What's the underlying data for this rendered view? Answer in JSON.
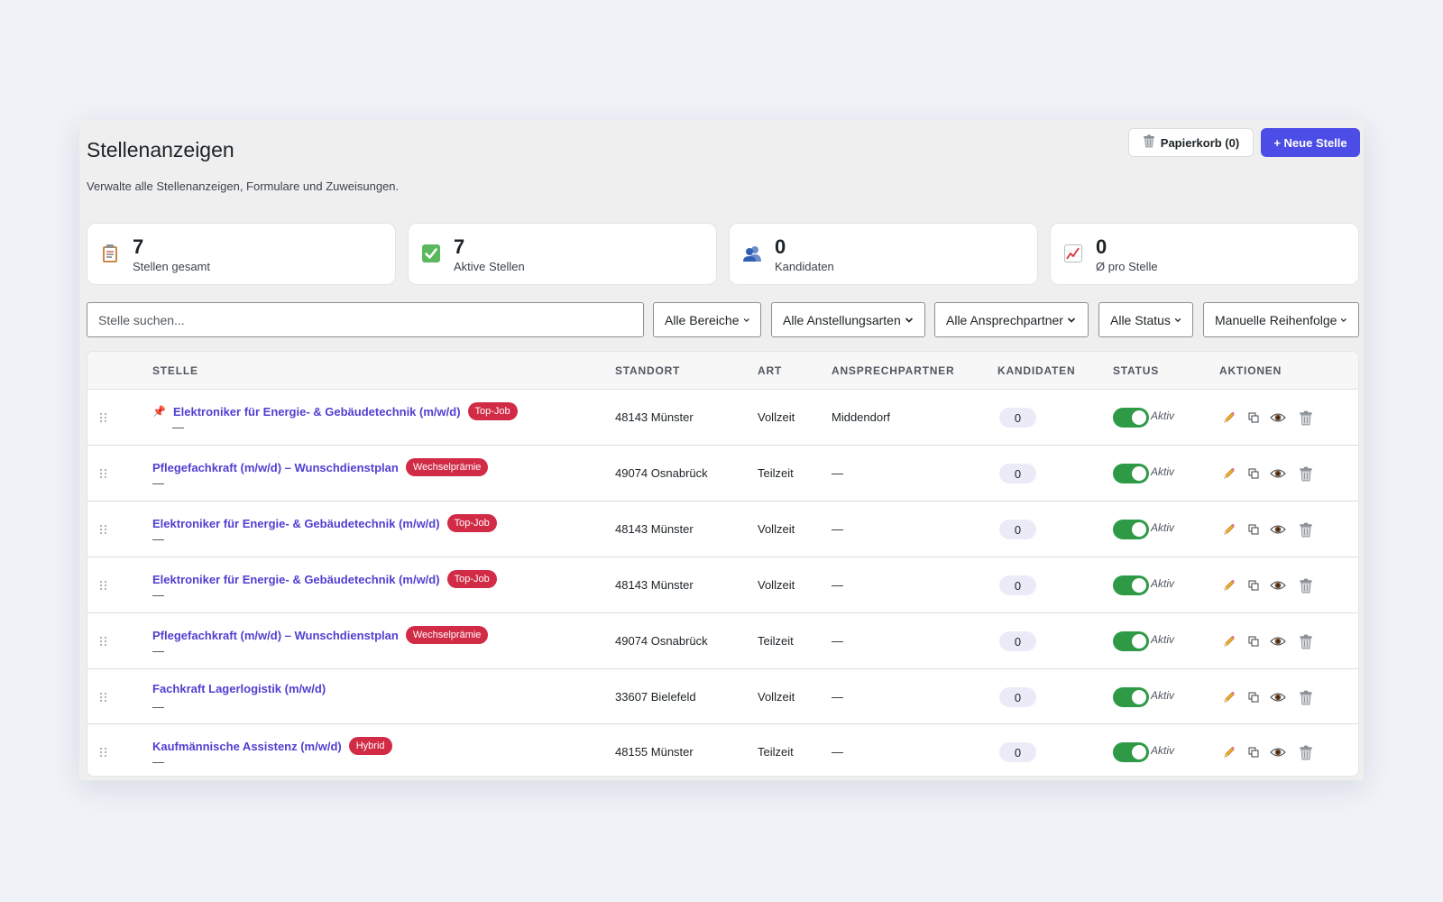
{
  "header": {
    "title": "Stellenanzeigen",
    "subtitle": "Verwalte alle Stellenanzeigen, Formulare und Zuweisungen.",
    "trash_label": "Papierkorb (0)",
    "new_label": "+ Neue Stelle"
  },
  "stats": [
    {
      "value": "7",
      "label": "Stellen gesamt",
      "icon": "clipboard-icon"
    },
    {
      "value": "7",
      "label": "Aktive Stellen",
      "icon": "checkmark-icon"
    },
    {
      "value": "0",
      "label": "Kandidaten",
      "icon": "people-icon"
    },
    {
      "value": "0",
      "label": "Ø pro Stelle",
      "icon": "chart-icon"
    }
  ],
  "filters": {
    "search_placeholder": "Stelle suchen...",
    "bereiche": "Alle Bereiche",
    "anstellungsarten": "Alle Anstellungsarten",
    "ansprechpartner": "Alle Ansprechpartner",
    "status": "Alle Status",
    "sort": "Manuelle Reihenfolge"
  },
  "table": {
    "headers": [
      "STELLE",
      "STANDORT",
      "ART",
      "ANSPRECHPARTNER",
      "KANDIDATEN",
      "STATUS",
      "AKTIONEN"
    ],
    "rows": [
      {
        "title": "Elektroniker für Energie- & Gebäudetechnik (m/w/d)",
        "badge": "Top-Job",
        "pinned": true,
        "sub": "—",
        "standort": "48143 Münster",
        "art": "Vollzeit",
        "ansprechpartner": "Middendorf",
        "kandidaten": "0",
        "status": "Aktiv"
      },
      {
        "title": "Pflegefachkraft (m/w/d) – Wunschdienstplan",
        "badge": "Wechselprämie",
        "pinned": false,
        "sub": "—",
        "standort": "49074 Osnabrück",
        "art": "Teilzeit",
        "ansprechpartner": "—",
        "kandidaten": "0",
        "status": "Aktiv"
      },
      {
        "title": "Elektroniker für Energie- & Gebäudetechnik (m/w/d)",
        "badge": "Top-Job",
        "pinned": false,
        "sub": "—",
        "standort": "48143 Münster",
        "art": "Vollzeit",
        "ansprechpartner": "—",
        "kandidaten": "0",
        "status": "Aktiv"
      },
      {
        "title": "Elektroniker für Energie- & Gebäudetechnik (m/w/d)",
        "badge": "Top-Job",
        "pinned": false,
        "sub": "—",
        "standort": "48143 Münster",
        "art": "Vollzeit",
        "ansprechpartner": "—",
        "kandidaten": "0",
        "status": "Aktiv"
      },
      {
        "title": "Pflegefachkraft (m/w/d) – Wunschdienstplan",
        "badge": "Wechselprämie",
        "pinned": false,
        "sub": "—",
        "standort": "49074 Osnabrück",
        "art": "Teilzeit",
        "ansprechpartner": "—",
        "kandidaten": "0",
        "status": "Aktiv"
      },
      {
        "title": "Fachkraft Lagerlogistik (m/w/d)",
        "badge": "",
        "pinned": false,
        "sub": "—",
        "standort": "33607 Bielefeld",
        "art": "Vollzeit",
        "ansprechpartner": "—",
        "kandidaten": "0",
        "status": "Aktiv"
      },
      {
        "title": "Kaufmännische Assistenz (m/w/d)",
        "badge": "Hybrid",
        "pinned": false,
        "sub": "—",
        "standort": "48155 Münster",
        "art": "Teilzeit",
        "ansprechpartner": "—",
        "kandidaten": "0",
        "status": "Aktiv"
      }
    ]
  },
  "colors": {
    "accent": "#4c4ce6",
    "link": "#4f3fd0",
    "badge": "#d12b46",
    "toggle_on": "#2e9a46"
  }
}
